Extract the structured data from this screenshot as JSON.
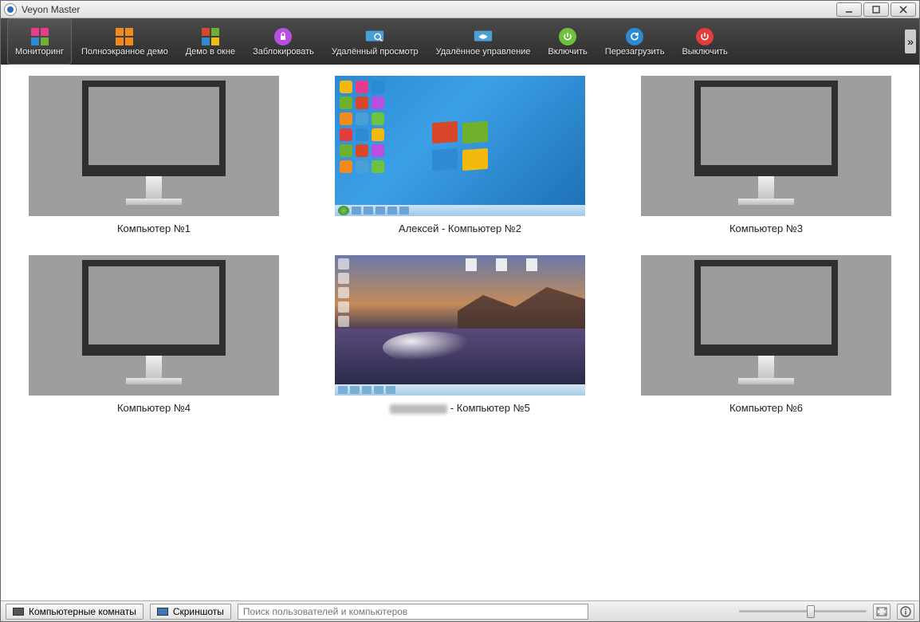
{
  "window": {
    "title": "Veyon Master"
  },
  "toolbar": {
    "monitoring": "Мониторинг",
    "fullscreen_demo": "Полноэкранное демо",
    "window_demo": "Демо в окне",
    "lock": "Заблокировать",
    "remote_view": "Удалённый просмотр",
    "remote_control": "Удалённое управление",
    "power_on": "Включить",
    "reboot": "Перезагрузить",
    "power_off": "Выключить"
  },
  "computers": [
    {
      "label": "Компьютер №1",
      "live": false
    },
    {
      "label": "Алексей - Компьютер №2",
      "live": true,
      "variant": 1
    },
    {
      "label": "Компьютер №3",
      "live": false
    },
    {
      "label": "Компьютер №4",
      "live": false
    },
    {
      "label_suffix": " - Компьютер №5",
      "live": true,
      "variant": 2,
      "name_obscured": true
    },
    {
      "label": "Компьютер №6",
      "live": false
    }
  ],
  "statusbar": {
    "rooms": "Компьютерные комнаты",
    "screenshots": "Скриншоты",
    "search_placeholder": "Поиск пользователей и компьютеров"
  }
}
